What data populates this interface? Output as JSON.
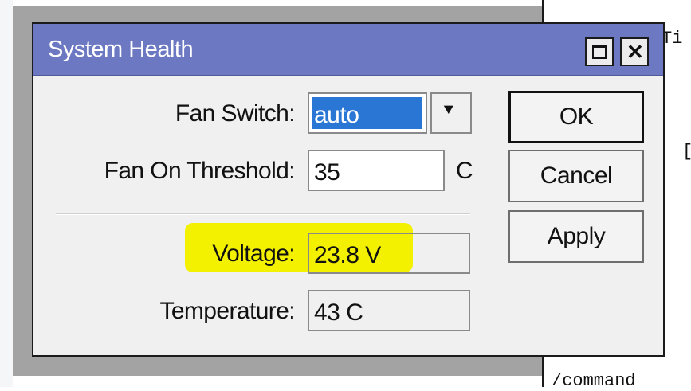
{
  "window": {
    "title": "System Health",
    "maximize_icon": "maximize-icon",
    "close_icon": "close-icon",
    "close_glyph": "✕"
  },
  "fields": {
    "fan_switch": {
      "label": "Fan Switch:",
      "value": "auto",
      "dropdown_glyph": "⯆"
    },
    "fan_threshold": {
      "label": "Fan On Threshold:",
      "value": "35",
      "unit": "C"
    },
    "voltage": {
      "label": "Voltage:",
      "value": "23.8 V"
    },
    "temperature": {
      "label": "Temperature:",
      "value": "43 C"
    }
  },
  "buttons": {
    "ok": "OK",
    "cancel": "Cancel",
    "apply": "Apply"
  },
  "background_terminal": {
    "line1": "Ti",
    "line2": "[",
    "line3": "/command"
  },
  "colors": {
    "titlebar": "#6c79c2",
    "highlight": "#f3f000",
    "selection": "#2a76d4"
  }
}
